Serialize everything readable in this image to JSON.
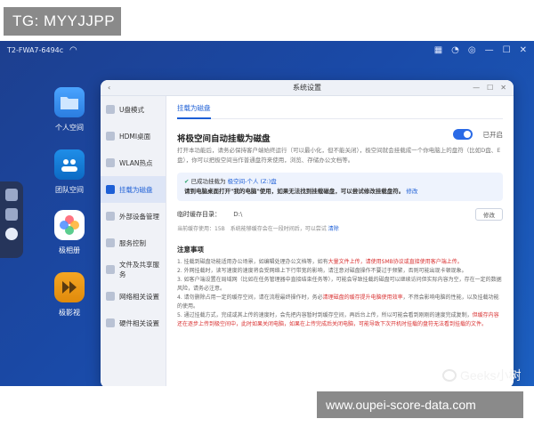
{
  "overlays": {
    "top_badge": "TG: MYYJJPP",
    "bottom_badge": "www.oupei-score-data.com",
    "watermark": "Geeks小树"
  },
  "statusbar": {
    "device": "T2-FWA7-6494c"
  },
  "desktop_apps": [
    {
      "label": "个人空间"
    },
    {
      "label": "团队空间"
    },
    {
      "label": "极相册"
    },
    {
      "label": "极影视"
    }
  ],
  "window": {
    "title": "系统设置",
    "sidebar": [
      {
        "label": "U盘模式"
      },
      {
        "label": "HDMI桌面"
      },
      {
        "label": "WLAN热点"
      },
      {
        "label": "挂载为磁盘"
      },
      {
        "label": "外部设备管理"
      },
      {
        "label": "服务控制"
      },
      {
        "label": "文件及共享服务"
      },
      {
        "label": "网络相关设置"
      },
      {
        "label": "硬件相关设置"
      }
    ],
    "tab": "挂载为磁盘",
    "heading": "将极空间自动挂载为磁盘",
    "toggle_label": "已开启",
    "description": "打开本功能后，请务必保持客户端始终运行（可以最小化，但不能关闭），极空间就会挂载成一个你电脑上的盘符（比如D盘、E盘），你可以把极空间当作普通盘符来使用，浏览、存储办公文档等。",
    "success": {
      "prefix": "已成功挂载为",
      "link": "极空间-个人 (Z:)盘",
      "line2_bold": "请到电脑桌面打开\"我的电脑\"使用，如果无法找到挂载磁盘，可以尝试修改挂载盘符。",
      "modify_link": "修改"
    },
    "cache": {
      "label": "临时缓存目录：",
      "path": "D:\\",
      "edit": "修改",
      "info": "当前缓存使用：15B　系统能够缓存会在一段时间后，可以尝试",
      "info_link": "清除"
    },
    "notes_title": "注意事项",
    "notes": [
      "1. 挂载到磁盘功能适用办公场景，如编辑处理办公文档等，如有",
      "大量文件上传，请使用SMB协议或直接使用客户端上传。",
      "2. 外网挂载时，读写速度的速度将会受网络上下行带宽的影响，请注意对磁盘操作不要过于频繁，否则可能出现卡顿现象。",
      "3. 如客户端设置在局域网（比如在任务管理器中直接结束任务等），可能会导致挂载的磁盘可以继续访问但实际内容为空，存在一定的数据风险，请务必注意。",
      "4. 请勿删除占用一定的缓存空间，请在流程最终操作时，务必",
      "清理磁盘的缓存提升电脑使用效率",
      "，不然会影响电脑的性能，以及挂载功能的使用。",
      "5. 通过挂载方式，完成或其上传的速度时，会先把内容暂时到缓存空间，再后台上传，所以可能会看到刚刚的速度完成复制，",
      "但缓存内容还在逐步上传到极空间中，此时如果关闭电脑，如果在上传完成后关闭电脑，可能导致下次开机时挂载的盘符无法看到挂载的文件。"
    ]
  }
}
